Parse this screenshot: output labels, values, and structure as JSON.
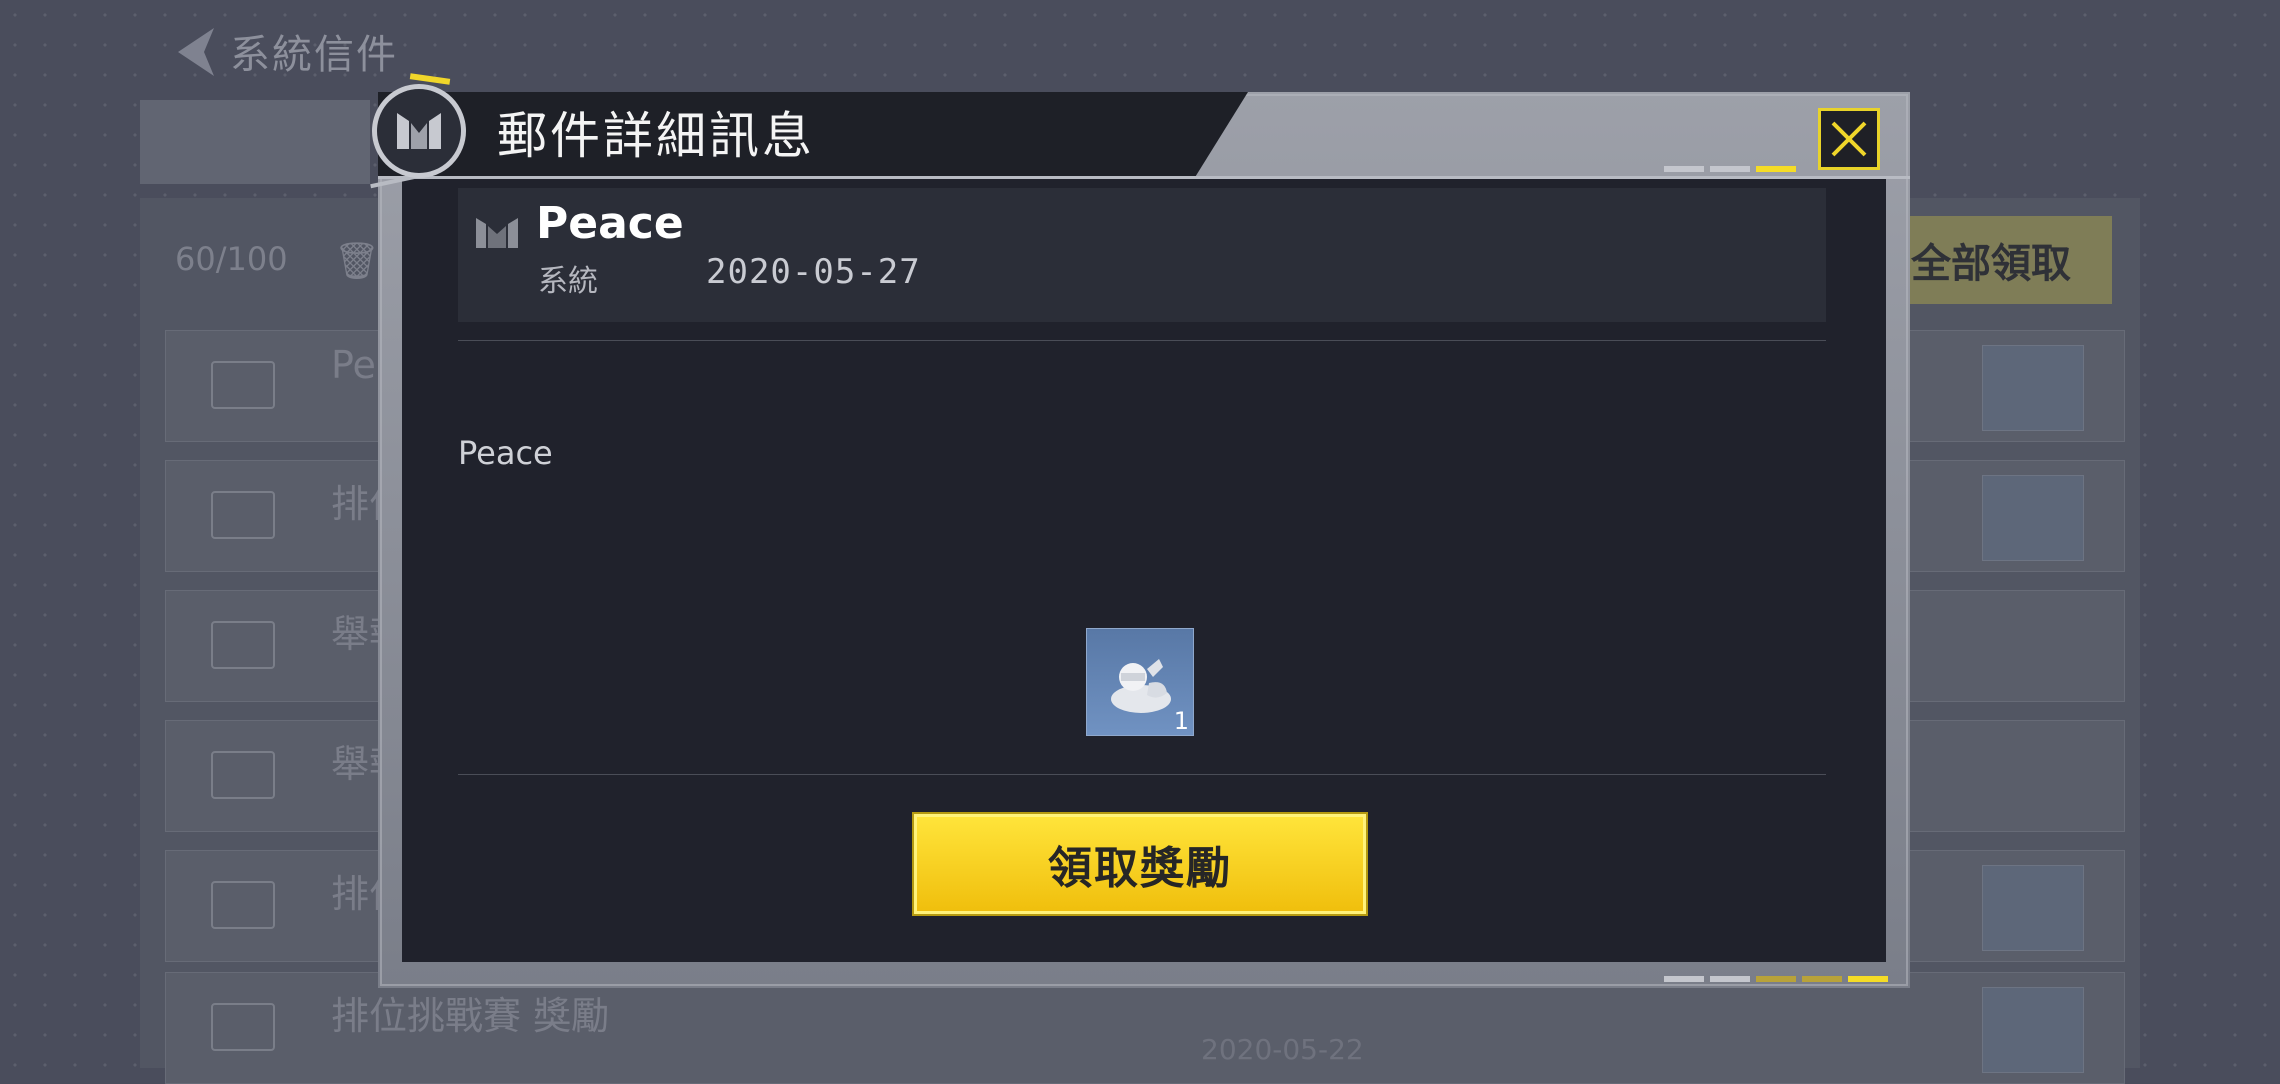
{
  "background": {
    "title": "系統信件",
    "mail_count": "60/100",
    "claim_all_label": "全部領取",
    "rows": [
      {
        "title": "Peace",
        "subtitle": "",
        "date": ""
      },
      {
        "title": "排位",
        "subtitle": "",
        "date": ""
      },
      {
        "title": "舉報",
        "subtitle": "",
        "date": ""
      },
      {
        "title": "舉報",
        "subtitle": "",
        "date": ""
      },
      {
        "title": "排位",
        "subtitle": "",
        "date": ""
      },
      {
        "title": "排位挑戰賽 獎勵",
        "subtitle": "",
        "date": "2020-05-22"
      }
    ]
  },
  "modal": {
    "title": "郵件詳細訊息",
    "sender": "Peace",
    "sender_type": "系統",
    "date": "2020-05-27",
    "body": "Peace",
    "reward": {
      "icon": "reward-bag-icon",
      "count": "1"
    },
    "claim_label": "領取獎勵"
  },
  "colors": {
    "accent_yellow": "#f5d21a",
    "panel_dark": "#20222c",
    "reward_blue": "#5f80b0"
  }
}
